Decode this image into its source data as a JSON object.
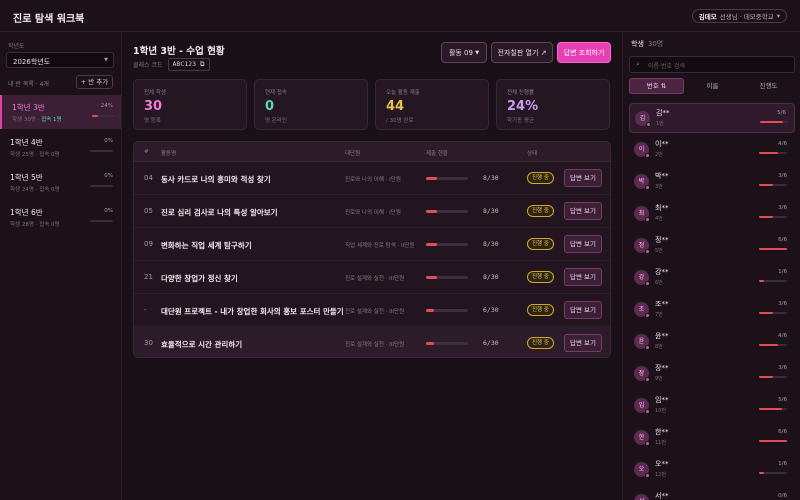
{
  "app": {
    "title": "진로 탐색 워크북"
  },
  "user": {
    "name": "김데모",
    "role": "선생님 · 데모중학교"
  },
  "sidebar": {
    "year_label": "학년도",
    "year_value": "2026학년도",
    "my_classes": "내 반 목록 · 4개",
    "add_class": "+ 반 추가",
    "classes": [
      {
        "name": "1학년 3반",
        "sub": "학생 30명 · ",
        "highlight": "접속 1명",
        "pct": "24%",
        "progress": 24
      },
      {
        "name": "1학년 4반",
        "sub": "학생 25명 · 접속 0명",
        "highlight": "",
        "pct": "0%",
        "progress": 0
      },
      {
        "name": "1학년 5반",
        "sub": "학생 24명 · 접속 0명",
        "highlight": "",
        "pct": "0%",
        "progress": 0
      },
      {
        "name": "1학년 6반",
        "sub": "학생 28명 · 접속 0명",
        "highlight": "",
        "pct": "0%",
        "progress": 0
      }
    ]
  },
  "main": {
    "title": "1학년 3반 - 수업 현황",
    "class_code_label": "클래스 코드",
    "class_code": "ABC123",
    "activity_select": "활동 09",
    "fullscreen_btn": "전자칠판 열기 ↗",
    "answers_btn": "답변 조회하기",
    "stats": [
      {
        "label": "전체 학생",
        "value": "30",
        "sub": "명 등록",
        "color": "#f37ad0"
      },
      {
        "label": "현재 접속",
        "value": "0",
        "sub": "명 온라인",
        "color": "#5fd6b0"
      },
      {
        "label": "오늘 활동 제출",
        "value": "44",
        "sub": "/ 30명 완료",
        "color": "#e8c14a"
      },
      {
        "label": "전체 진행률",
        "value": "24%",
        "sub": "학기종 평균",
        "color": "#c79cf5"
      }
    ]
  },
  "table": {
    "headers": {
      "num": "#",
      "title": "활동명",
      "unit": "대단원",
      "status": "제출 현황",
      "state": "상태"
    },
    "rows": [
      {
        "num": "04",
        "title": "동사 카드로 나의 흥미와 적성 찾기",
        "unit": "진로와 나의 이해 · I단원",
        "count": "8/30",
        "progress": 26.7,
        "badge": "진행 중",
        "action": "답변 보기"
      },
      {
        "num": "05",
        "title": "진로 심리 검사로 나의 특성 알아보기",
        "unit": "진로와 나의 이해 · I단원",
        "count": "8/30",
        "progress": 26.7,
        "badge": "진행 중",
        "action": "답변 보기"
      },
      {
        "num": "09",
        "title": "변화하는 직업 세계 탐구하기",
        "unit": "직업 세계와 진로 탐색 · II단원",
        "count": "8/30",
        "progress": 26.7,
        "badge": "진행 중",
        "action": "답변 보기"
      },
      {
        "num": "21",
        "title": "다양한 창업가 정신 찾기",
        "unit": "진로 설계와 실천 · III단원",
        "count": "8/30",
        "progress": 26.7,
        "badge": "진행 중",
        "action": "답변 보기"
      },
      {
        "num": "-",
        "title": "대단원 프로젝트 - 내가 창업한 회사의 홍보 포스터 만들기",
        "unit": "진로 설계와 실천 · III단원",
        "count": "6/30",
        "progress": 20,
        "badge": "진행 중",
        "action": "답변 보기"
      },
      {
        "num": "30",
        "title": "효율적으로 시간 관리하기",
        "unit": "진로 설계와 실천 · III단원",
        "count": "6/30",
        "progress": 20,
        "badge": "진행 중",
        "action": "답변 보기"
      }
    ]
  },
  "students_panel": {
    "title": "학생",
    "count": "30명",
    "search_placeholder": "이름·번호 검색",
    "sort_tabs": [
      "번호 ⇅",
      "이름",
      "진행도"
    ],
    "students": [
      {
        "initial": "김",
        "name": "김**",
        "num": "1번",
        "score": "5/6",
        "progress": 83
      },
      {
        "initial": "이",
        "name": "이**",
        "num": "2번",
        "score": "4/6",
        "progress": 67
      },
      {
        "initial": "박",
        "name": "박**",
        "num": "3번",
        "score": "3/6",
        "progress": 50
      },
      {
        "initial": "최",
        "name": "최**",
        "num": "4번",
        "score": "3/6",
        "progress": 50
      },
      {
        "initial": "정",
        "name": "정**",
        "num": "5번",
        "score": "6/6",
        "progress": 100
      },
      {
        "initial": "강",
        "name": "강**",
        "num": "6번",
        "score": "1/6",
        "progress": 17
      },
      {
        "initial": "조",
        "name": "조**",
        "num": "7번",
        "score": "3/6",
        "progress": 50
      },
      {
        "initial": "윤",
        "name": "윤**",
        "num": "8번",
        "score": "4/6",
        "progress": 67
      },
      {
        "initial": "장",
        "name": "장**",
        "num": "9번",
        "score": "3/6",
        "progress": 50
      },
      {
        "initial": "임",
        "name": "임**",
        "num": "10번",
        "score": "5/6",
        "progress": 83
      },
      {
        "initial": "한",
        "name": "한**",
        "num": "11번",
        "score": "6/6",
        "progress": 100
      },
      {
        "initial": "오",
        "name": "오**",
        "num": "12번",
        "score": "1/6",
        "progress": 17
      },
      {
        "initial": "서",
        "name": "서**",
        "num": "13번",
        "score": "0/6",
        "progress": 0
      }
    ]
  }
}
